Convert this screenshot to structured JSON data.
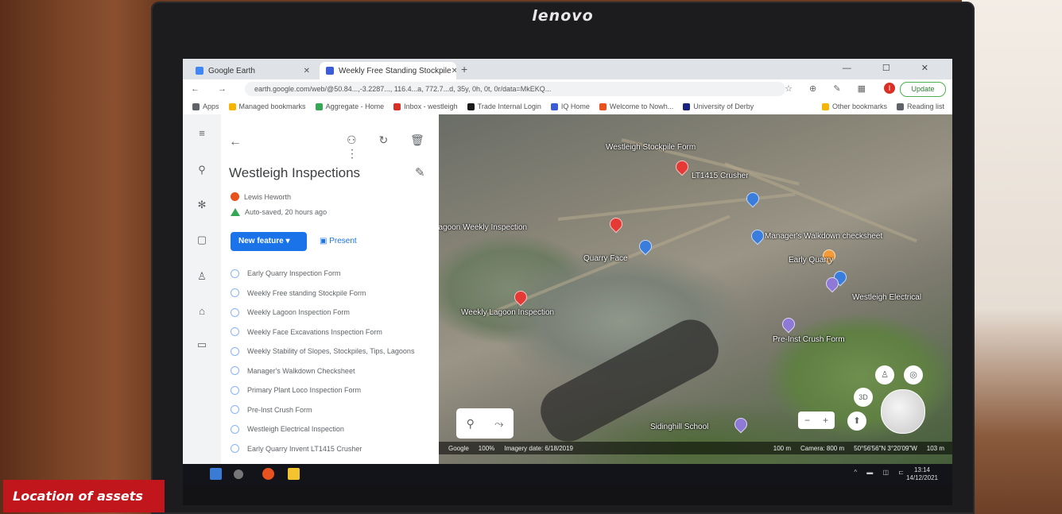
{
  "monitor_brand": "lenovo",
  "caption": "Location of assets",
  "browser": {
    "tabs": [
      {
        "title": "Google Earth",
        "active": false,
        "favicon_color": "#4285f4"
      },
      {
        "title": "Weekly Free Standing Stockpile",
        "active": true,
        "favicon_color": "#3c5bd8"
      }
    ],
    "new_tab_label": "+",
    "window_controls": "— ☐ ✕",
    "nav": "← → C",
    "url": "earth.google.com/web/@50.84...,-3.2287..., 116.4...a, 772.7...d, 35y, 0h, 0t, 0r/data=MkEKQ...",
    "profile_initial": "I",
    "update_label": "Update",
    "bookmarks": [
      {
        "label": "Apps",
        "color": "#5f6368"
      },
      {
        "label": "Managed bookmarks",
        "color": "#f4b400"
      },
      {
        "label": "Aggregate - Home",
        "color": "#34a853"
      },
      {
        "label": "Inbox - westleigh",
        "color": "#d93025"
      },
      {
        "label": "Trade Internal Login",
        "color": "#1a1a1a"
      },
      {
        "label": "IQ Home",
        "color": "#3c5bd8"
      },
      {
        "label": "Welcome to Nowh...",
        "color": "#e8521e"
      },
      {
        "label": "University of Derby",
        "color": "#1a237e"
      }
    ],
    "other_bookmarks": "Other bookmarks",
    "reading_list": "Reading list"
  },
  "earth": {
    "panel": {
      "title": "Westleigh Inspections",
      "owner": "Lewis Heworth",
      "saved": "Auto-saved, 20 hours ago",
      "new_feature_label": "New feature",
      "present_label": "Present",
      "features": [
        "Early Quarry Inspection Form",
        "Weekly Free standing Stockpile Form",
        "Weekly Lagoon Inspection Form",
        "Weekly Face Excavations Inspection Form",
        "Weekly Stability of Slopes, Stockpiles, Tips, Lagoons",
        "Manager's Walkdown Checksheet",
        "Primary Plant Loco Inspection Form",
        "Pre-Inst Crush Form",
        "Westleigh Electrical Inspection",
        "Early Quarry Invent LT1415 Crusher"
      ]
    },
    "map_labels": [
      "Westleigh Stockpile Form",
      "LT1415 Crusher",
      "Lagoon Weekly Inspection",
      "Quarry Face",
      "Manager's Walkdown checksheet",
      "Early Quarry",
      "Westleigh Electrical",
      "Weekly Lagoon Inspection",
      "Pre-Inst Crush Form",
      "Sidinghill School"
    ],
    "map_tools": [
      "⚲",
      "⤳"
    ],
    "map_bar": {
      "provider": "Google",
      "zoom": "100%",
      "imagery": "Imagery date: 6/18/2019",
      "scale": "100 m",
      "camera": "Camera: 800 m",
      "coords": "50°56'56\"N 3°20'09\"W",
      "elev": "103 m"
    }
  },
  "taskbar": {
    "time": "13:14",
    "date": "14/12/2021"
  }
}
